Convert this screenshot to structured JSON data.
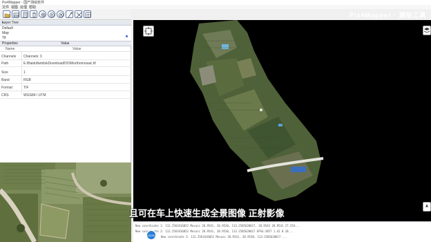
{
  "window": {
    "title": "Pix4Mapper - 国产测绘软件"
  },
  "menu": {
    "items": [
      "文件",
      "视图",
      "处理",
      "帮助"
    ]
  },
  "toolbar": {
    "tools": [
      {
        "icon": "open-folder-icon"
      },
      {
        "icon": "image-icon"
      },
      {
        "icon": "document-icon"
      },
      {
        "icon": "delete-icon"
      },
      {
        "icon": "camera-icon"
      },
      {
        "icon": "play-icon"
      },
      {
        "icon": "target-icon"
      },
      {
        "icon": "measure-icon"
      },
      {
        "icon": "tools-icon"
      },
      {
        "icon": "grid-icon"
      }
    ]
  },
  "panel": {
    "title": "Layer Tree",
    "pin": "▾",
    "tree": [
      "Default",
      "Map",
      "Tif"
    ]
  },
  "properties": {
    "header_left": "Properties",
    "header_mid": "Value",
    "col_key": "Name",
    "col_value": "Value",
    "rows": [
      {
        "key": "Channels",
        "value": "Channels: 3"
      },
      {
        "key": "Path",
        "value": "E:/BaiduNetdiskDownload/DOM/orthomosaic.tif"
      },
      {
        "key": "Size",
        "value": "1"
      },
      {
        "key": "Band",
        "value": "RGB"
      },
      {
        "key": "Format",
        "value": "TIF"
      },
      {
        "key": "CRS",
        "value": "WGS84 / UTM"
      }
    ]
  },
  "watermark": {
    "logo_text": "Pix4Mapper · 测绘工具"
  },
  "subtitle": {
    "text": "且可在车上快速生成全景图像 正射影像"
  },
  "log": {
    "lines": [
      "New coordinate 1: 112.2563416052 Mosaic 28.9541, 20.9530, 113.2505620017, 28.9543 28.9541 27.254...",
      "New coordinate 2: 112.2563416052 Mosaic 28.9541, 20.9530, 113.2505620017 EPSG:3857 1.42 0.10...",
      "New coordinate 3: 112.2563416052 Mosaic 28.9541, 20.9530, 113.2505620017 ..."
    ],
    "progress_label": "100%"
  },
  "colors": {
    "map_bg": "#000000",
    "accent": "#2e7dd8",
    "panel_header": "#e4e8ef"
  }
}
